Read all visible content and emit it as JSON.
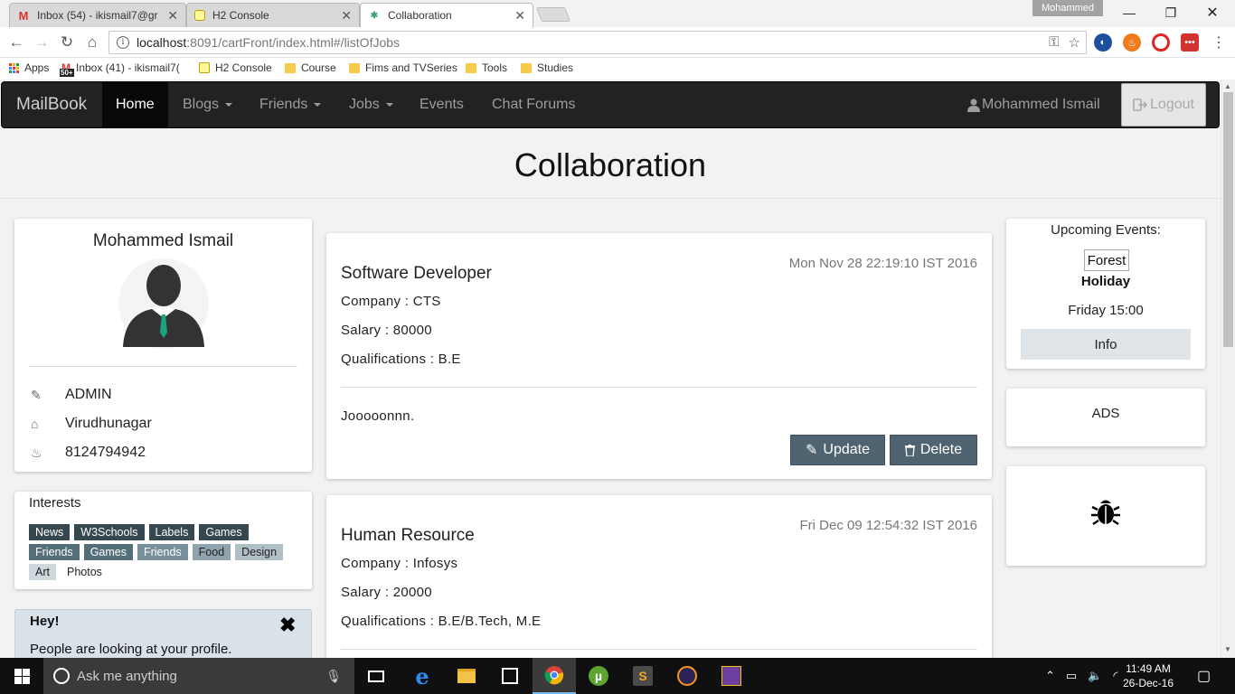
{
  "browser": {
    "tabs": [
      {
        "title": "Inbox (54) - ikismail7@gr",
        "favicon": "gmail-icon"
      },
      {
        "title": "H2 Console",
        "favicon": "h2-icon"
      },
      {
        "title": "Collaboration",
        "favicon": "slack-icon"
      }
    ],
    "profile_name": "Mohammed",
    "url_host": "localhost",
    "url_rest": ":8091/cartFront/index.html#/listOfJobs",
    "bookmarks": [
      {
        "label": "Apps"
      },
      {
        "label": "Inbox (41) - ikismail7("
      },
      {
        "label": "H2 Console"
      },
      {
        "label": "Course"
      },
      {
        "label": "Fims and TVSeries"
      },
      {
        "label": "Tools"
      },
      {
        "label": "Studies"
      }
    ],
    "gmail_badge": "50+"
  },
  "app": {
    "brand": "MailBook",
    "nav": [
      {
        "label": "Home",
        "active": true
      },
      {
        "label": "Blogs"
      },
      {
        "label": "Friends"
      },
      {
        "label": "Jobs"
      },
      {
        "label": "Events"
      },
      {
        "label": "Chat Forums"
      }
    ],
    "user_name": "Mohammed Ismail",
    "logout_label": "Logout",
    "page_title": "Collaboration"
  },
  "profile": {
    "name": "Mohammed Ismail",
    "role": "ADMIN",
    "city": "Virudhunagar",
    "phone": "8124794942"
  },
  "interests": {
    "title": "Interests",
    "tags": [
      {
        "label": "News",
        "bg": "#37474f",
        "fg": "#ffffff"
      },
      {
        "label": "W3Schools",
        "bg": "#37474f",
        "fg": "#ffffff"
      },
      {
        "label": "Labels",
        "bg": "#37474f",
        "fg": "#ffffff"
      },
      {
        "label": "Games",
        "bg": "#37474f",
        "fg": "#ffffff"
      },
      {
        "label": "Friends",
        "bg": "#546e7a",
        "fg": "#ffffff"
      },
      {
        "label": "Games",
        "bg": "#546e7a",
        "fg": "#ffffff"
      },
      {
        "label": "Friends",
        "bg": "#78909c",
        "fg": "#ffffff"
      },
      {
        "label": "Food",
        "bg": "#90a4ae",
        "fg": "#222222"
      },
      {
        "label": "Design",
        "bg": "#b0bec5",
        "fg": "#222222"
      },
      {
        "label": "Art",
        "bg": "#cfd8dc",
        "fg": "#222222"
      },
      {
        "label": "Photos",
        "bg": "#ffffff",
        "fg": "#222222"
      }
    ]
  },
  "alert": {
    "title": "Hey!",
    "text": "People are looking at your profile."
  },
  "jobs": [
    {
      "title": "Software Developer",
      "date": "Mon Nov 28 22:19:10 IST 2016",
      "company": "Company : CTS",
      "salary": "Salary : 80000",
      "qualifications": "Qualifications : B.E",
      "description": "Jooooonnn.",
      "update_label": "Update",
      "delete_label": "Delete"
    },
    {
      "title": "Human Resource",
      "date": "Fri Dec 09 12:54:32 IST 2016",
      "company": "Company : Infosys",
      "salary": "Salary : 20000",
      "qualifications": "Qualifications : B.E/B.Tech, M.E"
    }
  ],
  "events": {
    "title": "Upcoming Events:",
    "name_line1": "Forest",
    "name_line2": "Holiday",
    "time": "Friday 15:00",
    "info_label": "Info"
  },
  "ads": {
    "label": "ADS"
  },
  "taskbar": {
    "search_placeholder": "Ask me anything",
    "time": "11:49 AM",
    "date": "26-Dec-16"
  }
}
